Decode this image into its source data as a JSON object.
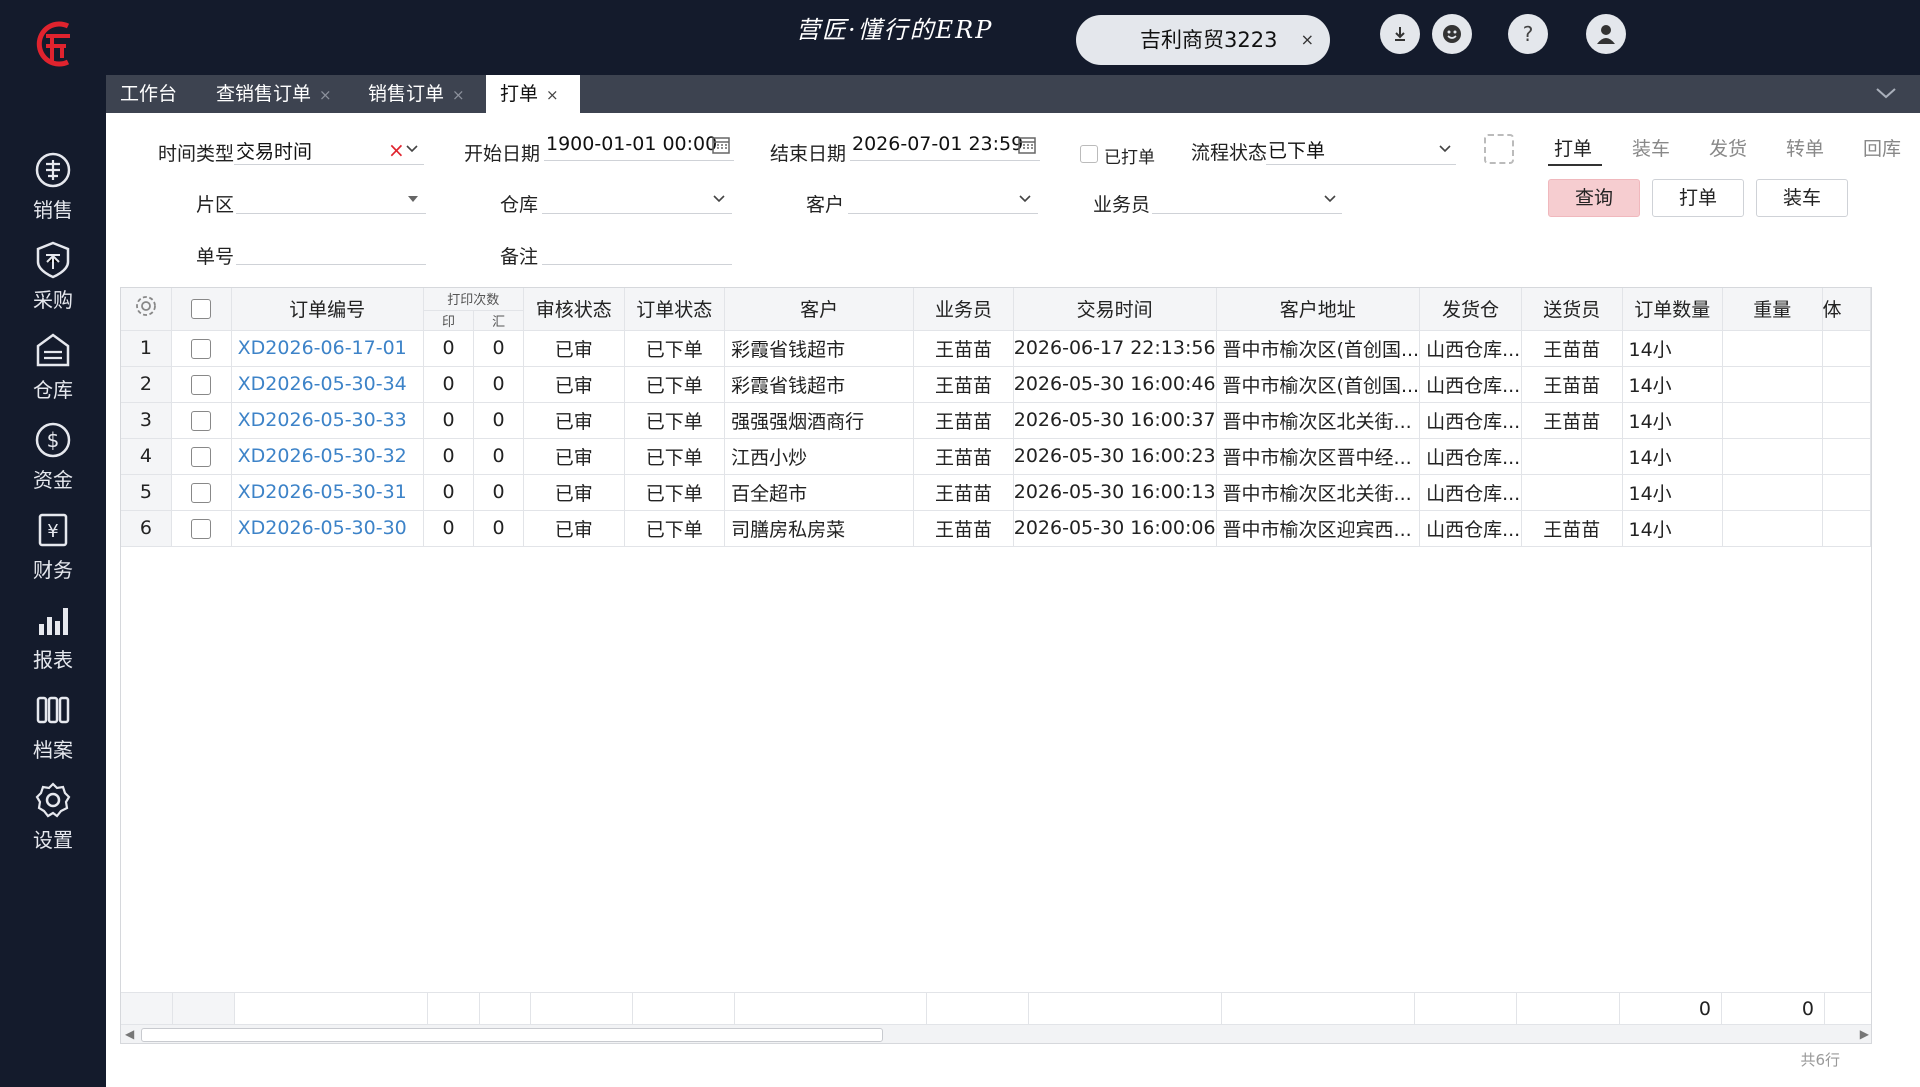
{
  "sidebar": {
    "items": [
      {
        "label": "销售",
        "icon": "sales-icon"
      },
      {
        "label": "采购",
        "icon": "purchase-icon"
      },
      {
        "label": "仓库",
        "icon": "warehouse-icon"
      },
      {
        "label": "资金",
        "icon": "funds-icon"
      },
      {
        "label": "财务",
        "icon": "finance-icon"
      },
      {
        "label": "报表",
        "icon": "report-icon"
      },
      {
        "label": "档案",
        "icon": "archive-icon"
      },
      {
        "label": "设置",
        "icon": "settings-icon"
      }
    ]
  },
  "header": {
    "slogan": "营匠·懂行的ERP",
    "company": "吉利商贸3223",
    "company_close": "×"
  },
  "tabs": [
    {
      "label": "工作台",
      "close": ""
    },
    {
      "label": "查销售订单",
      "close": "×"
    },
    {
      "label": "销售订单",
      "close": "×"
    },
    {
      "label": "打单",
      "close": "×"
    }
  ],
  "filters": {
    "time_type_label": "时间类型",
    "time_type_value": "交易时间",
    "clear_mark": "×",
    "start_label": "开始日期",
    "start_value": "1900-01-01 00:00",
    "end_label": "结束日期",
    "end_value": "2026-07-01 23:59",
    "printed_label": "已打单",
    "flow_label": "流程状态",
    "flow_value": "已下单",
    "area_label": "片区",
    "warehouse_label": "仓库",
    "customer_label": "客户",
    "salesman_label": "业务员",
    "order_no_label": "单号",
    "remark_label": "备注"
  },
  "modes": [
    "打单",
    "装车",
    "发货",
    "转单",
    "回库"
  ],
  "actions": {
    "query": "查询",
    "print": "打单",
    "load": "装车"
  },
  "grid": {
    "headers": {
      "order_no": "订单编号",
      "print_count": "打印次数",
      "print_sub": "印",
      "summary_sub": "汇",
      "audit": "审核状态",
      "status": "订单状态",
      "customer": "客户",
      "salesman": "业务员",
      "trade_time": "交易时间",
      "address": "客户地址",
      "ship_wh": "发货仓",
      "deliverer": "送货员",
      "qty": "订单数量",
      "weight": "重量",
      "more": "体"
    },
    "rows": [
      {
        "n": "1",
        "order_no": "XD2026-06-17-01",
        "p": "0",
        "s": "0",
        "audit": "已审",
        "status": "已下单",
        "customer": "彩霞省钱超市",
        "salesman": "王苗苗",
        "time": "2026-06-17 22:13:56",
        "address": "晋中市榆次区(首创国...",
        "wh": "山西仓库...",
        "deliverer": "王苗苗",
        "qty": "14小",
        "weight": ""
      },
      {
        "n": "2",
        "order_no": "XD2026-05-30-34",
        "p": "0",
        "s": "0",
        "audit": "已审",
        "status": "已下单",
        "customer": "彩霞省钱超市",
        "salesman": "王苗苗",
        "time": "2026-05-30 16:00:46",
        "address": "晋中市榆次区(首创国...",
        "wh": "山西仓库...",
        "deliverer": "王苗苗",
        "qty": "14小",
        "weight": ""
      },
      {
        "n": "3",
        "order_no": "XD2026-05-30-33",
        "p": "0",
        "s": "0",
        "audit": "已审",
        "status": "已下单",
        "customer": "强强强烟酒商行",
        "salesman": "王苗苗",
        "time": "2026-05-30 16:00:37",
        "address": "晋中市榆次区北关街...",
        "wh": "山西仓库...",
        "deliverer": "王苗苗",
        "qty": "14小",
        "weight": ""
      },
      {
        "n": "4",
        "order_no": "XD2026-05-30-32",
        "p": "0",
        "s": "0",
        "audit": "已审",
        "status": "已下单",
        "customer": "江西小炒",
        "salesman": "王苗苗",
        "time": "2026-05-30 16:00:23",
        "address": "晋中市榆次区晋中经...",
        "wh": "山西仓库...",
        "deliverer": "",
        "qty": "14小",
        "weight": ""
      },
      {
        "n": "5",
        "order_no": "XD2026-05-30-31",
        "p": "0",
        "s": "0",
        "audit": "已审",
        "status": "已下单",
        "customer": "百全超市",
        "salesman": "王苗苗",
        "time": "2026-05-30 16:00:13",
        "address": "晋中市榆次区北关街...",
        "wh": "山西仓库...",
        "deliverer": "",
        "qty": "14小",
        "weight": ""
      },
      {
        "n": "6",
        "order_no": "XD2026-05-30-30",
        "p": "0",
        "s": "0",
        "audit": "已审",
        "status": "已下单",
        "customer": "司膳房私房菜",
        "salesman": "王苗苗",
        "time": "2026-05-30 16:00:06",
        "address": "晋中市榆次区迎宾西...",
        "wh": "山西仓库...",
        "deliverer": "王苗苗",
        "qty": "14小",
        "weight": ""
      }
    ],
    "footer": {
      "qty_total": "0",
      "weight_total": "0"
    },
    "row_count": "共6行"
  },
  "colors": {
    "sidebar_bg": "#141b2c",
    "tabs_bg": "#3d4350",
    "link": "#3d83c8",
    "primary_btn": "#f6cdd0",
    "brand_red": "#e0232e"
  }
}
